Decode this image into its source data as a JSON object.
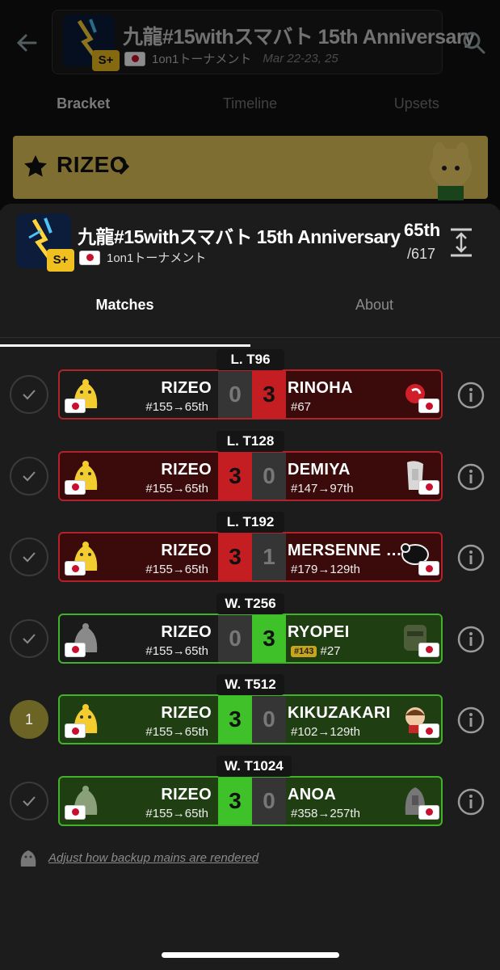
{
  "background_page": {
    "title": "九龍#15withスマバト 15th Anniversary",
    "subtitle": "1on1トーナメント",
    "date": "Mar 22-23, 25",
    "tabs": [
      "Bracket",
      "Timeline",
      "Upsets"
    ],
    "banner_player": "RIZEO",
    "badge": "S+"
  },
  "tournament": {
    "title": "九龍#15withスマバト 15th Anniversary",
    "event": "1on1トーナメント",
    "badge": "S+",
    "placement": "65th",
    "entrants": "/617"
  },
  "tabs": {
    "matches": "Matches",
    "about": "About"
  },
  "matches": [
    {
      "round": "L. T96",
      "status": "done",
      "p1_name": "RIZEO",
      "p1_seed": "#155→65th",
      "p1_score": "0",
      "p2_name": "RINOHA",
      "p2_seed": "#67",
      "p2_badge": "",
      "p2_score": "3",
      "result": "loss"
    },
    {
      "round": "L. T128",
      "status": "done",
      "p1_name": "RIZEO",
      "p1_seed": "#155→65th",
      "p1_score": "3",
      "p2_name": "DEMIYA",
      "p2_seed": "#147→97th",
      "p2_badge": "",
      "p2_score": "0",
      "result": "win-red"
    },
    {
      "round": "L. T192",
      "status": "done",
      "p1_name": "RIZEO",
      "p1_seed": "#155→65th",
      "p1_score": "3",
      "p2_name": "MERSENNE PRI...",
      "p2_seed": "#179→129th",
      "p2_badge": "",
      "p2_score": "1",
      "result": "win-red"
    },
    {
      "round": "W. T256",
      "status": "done",
      "p1_name": "RIZEO",
      "p1_seed": "#155→65th",
      "p1_score": "0",
      "p2_name": "RYOPEI",
      "p2_seed": "#27",
      "p2_badge": "#143",
      "p2_score": "3",
      "result": "loss-green"
    },
    {
      "round": "W. T512",
      "status": "1",
      "p1_name": "RIZEO",
      "p1_seed": "#155→65th",
      "p1_score": "3",
      "p2_name": "KIKUZAKARI",
      "p2_seed": "#102→129th",
      "p2_badge": "",
      "p2_score": "0",
      "result": "win"
    },
    {
      "round": "W. T1024",
      "status": "done",
      "p1_name": "RIZEO",
      "p1_seed": "#155→65th",
      "p1_score": "3",
      "p2_name": "ANOA",
      "p2_seed": "#358→257th",
      "p2_badge": "",
      "p2_score": "0",
      "result": "win"
    }
  ],
  "footer": {
    "link": "Adjust how backup mains are rendered"
  },
  "colors": {
    "win": "#3fc12a",
    "loss": "#c41d22",
    "banner": "#e8c85a",
    "badge": "#f0c020"
  }
}
